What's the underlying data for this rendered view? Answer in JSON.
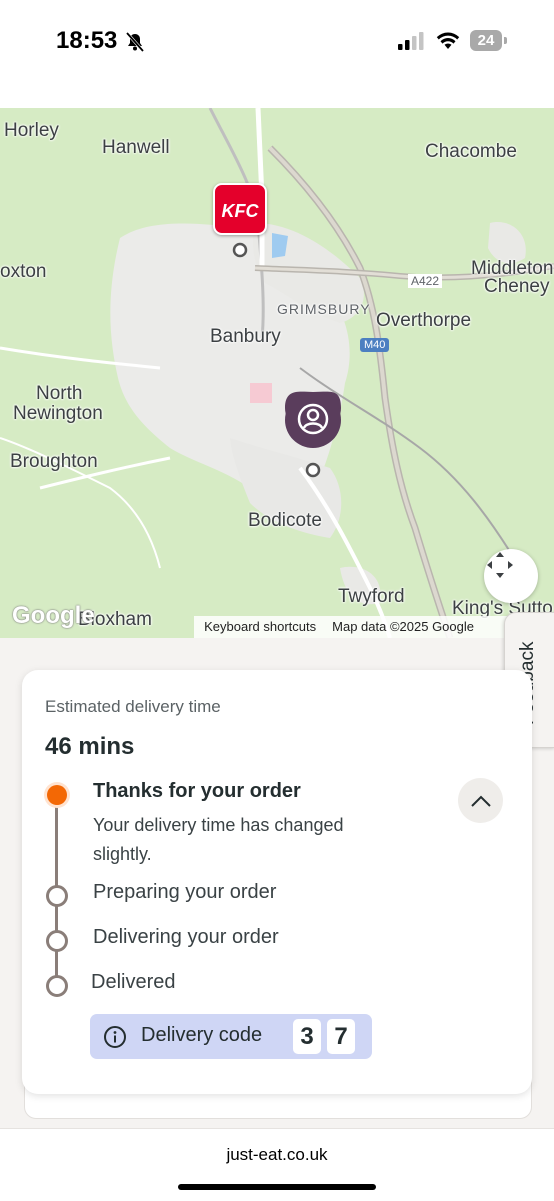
{
  "status_bar": {
    "time": "18:53",
    "battery": "24"
  },
  "map": {
    "places": [
      {
        "key": "horley",
        "label": "Horley"
      },
      {
        "key": "hanwell",
        "label": "Hanwell"
      },
      {
        "key": "chacombe",
        "label": "Chacombe"
      },
      {
        "key": "middleton1",
        "label": "Middleton"
      },
      {
        "key": "middleton2",
        "label": "Cheney"
      },
      {
        "key": "oxton",
        "label": "oxton"
      },
      {
        "key": "grimsbury",
        "label": "GRIMSBURY"
      },
      {
        "key": "overthorpe",
        "label": "Overthorpe"
      },
      {
        "key": "banbury",
        "label": "Banbury"
      },
      {
        "key": "north1",
        "label": "North"
      },
      {
        "key": "north2",
        "label": "Newington"
      },
      {
        "key": "broughton",
        "label": "Broughton"
      },
      {
        "key": "bodicote",
        "label": "Bodicote"
      },
      {
        "key": "twyford",
        "label": "Twyford"
      },
      {
        "key": "kings",
        "label": "King's Sutto"
      },
      {
        "key": "bloxham",
        "label": "Bloxham"
      }
    ],
    "road_labels": {
      "a422": "A422",
      "m40": "M40"
    },
    "restaurant_pin_label": "KFC",
    "google_logo": "Google",
    "attribution": {
      "shortcuts": "Keyboard shortcuts",
      "copyright": "Map data ©2025 Google"
    }
  },
  "feedback_label": "Feedback",
  "order": {
    "estimate_label": "Estimated delivery time",
    "estimate_value": "46 mins",
    "current_step_title": "Thanks for your order",
    "current_step_message": "Your delivery time has changed slightly.",
    "steps": [
      "Preparing your order",
      "Delivering your order",
      "Delivered"
    ],
    "delivery_code_label": "Delivery code",
    "delivery_code_digits": [
      "3",
      "7"
    ],
    "accent_color": "#f36805"
  },
  "footer": {
    "url": "just-eat.co.uk"
  }
}
